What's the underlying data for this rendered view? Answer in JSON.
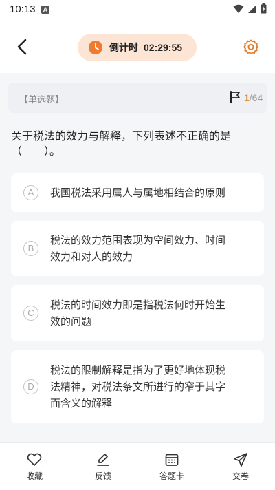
{
  "status_bar": {
    "time": "10:13",
    "notification_letter": "A"
  },
  "header": {
    "timer_label": "倒计时",
    "timer_value": "02:29:55"
  },
  "question": {
    "type": "【单选题】",
    "current_index": "1",
    "total": "/64",
    "stem_line1": "关于税法的效力与解释，下列表述不正确的是",
    "stem_line2": "（　　）。",
    "options": [
      {
        "letter": "A",
        "lines": [
          "我国税法采用属人与属地相结合的原则"
        ]
      },
      {
        "letter": "B",
        "lines": [
          "税法的效力范围表现为空间效力、时间",
          "效力和对人的效力"
        ]
      },
      {
        "letter": "C",
        "lines": [
          "税法的时间效力即是指税法何时开始生",
          "效的问题"
        ]
      },
      {
        "letter": "D",
        "lines": [
          "税法的限制解释是指为了更好地体现税",
          "法精神，对税法条文所进行的窄于其字",
          "面含义的解释"
        ]
      }
    ]
  },
  "tabbar": {
    "favorite": "收藏",
    "feedback": "反馈",
    "answer_sheet": "答题卡",
    "submit": "交卷"
  },
  "colors": {
    "accent": "#e38a3c",
    "timer_bg": "#fde5d6",
    "timer_icon": "#f07a2e"
  }
}
